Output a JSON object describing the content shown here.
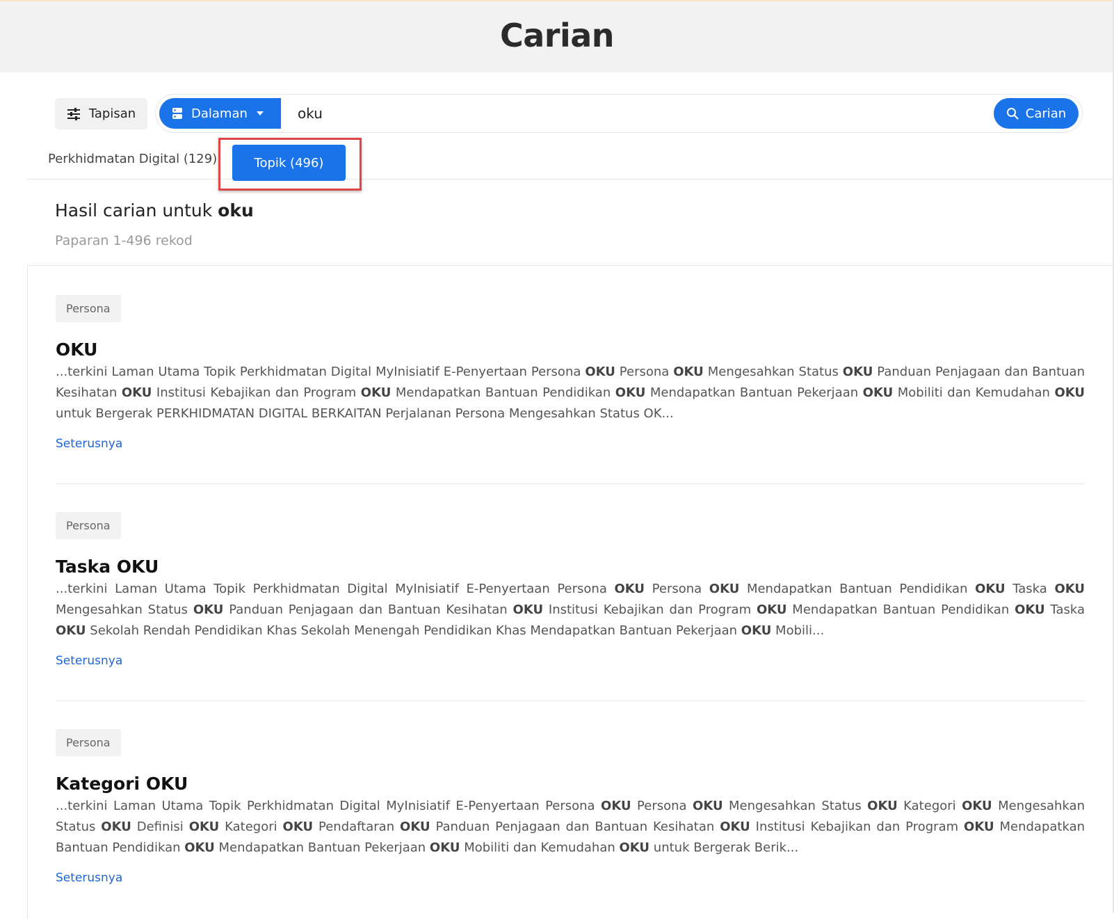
{
  "page": {
    "title": "Carian"
  },
  "toolbar": {
    "filter_label": "Tapisan",
    "scope_label": "Dalaman",
    "search_value": "oku",
    "search_button_label": "Carian"
  },
  "tabs": [
    {
      "label": "Perkhidmatan Digital (129)",
      "active": false
    },
    {
      "label": "Topik (496)",
      "active": true
    }
  ],
  "results_header": {
    "prefix": "Hasil carian untuk ",
    "query": "oku",
    "count_text": "Paparan 1-496 rekod"
  },
  "results": [
    {
      "badge": "Persona",
      "title": "OKU",
      "snippet": "...terkini Laman Utama Topik Perkhidmatan Digital MyInisiatif E-Penyertaan Persona OKU Persona OKU Mengesahkan Status OKU Panduan Penjagaan dan Bantuan Kesihatan OKU Institusi Kebajikan dan Program OKU Mendapatkan Bantuan Pendidikan OKU Mendapatkan Bantuan Pekerjaan OKU Mobiliti dan Kemudahan OKU untuk Bergerak PERKHIDMATAN DIGITAL BERKAITAN Perjalanan Persona Mengesahkan Status OK...",
      "more_label": "Seterusnya"
    },
    {
      "badge": "Persona",
      "title": "Taska OKU",
      "snippet": "...terkini Laman Utama Topik Perkhidmatan Digital MyInisiatif E-Penyertaan Persona OKU Persona OKU Mendapatkan Bantuan Pendidikan OKU Taska OKU Mengesahkan Status OKU Panduan Penjagaan dan Bantuan Kesihatan OKU Institusi Kebajikan dan Program OKU Mendapatkan Bantuan Pendidikan OKU Taska OKU Sekolah Rendah Pendidikan Khas Sekolah Menengah Pendidikan Khas Mendapatkan Bantuan Pekerjaan OKU Mobili...",
      "more_label": "Seterusnya"
    },
    {
      "badge": "Persona",
      "title": "Kategori OKU",
      "snippet": "...terkini Laman Utama Topik Perkhidmatan Digital MyInisiatif E-Penyertaan Persona OKU Persona OKU Mengesahkan Status OKU Kategori OKU Mengesahkan Status OKU Definisi OKU Kategori OKU Pendaftaran OKU Panduan Penjagaan dan Bantuan Kesihatan OKU Institusi Kebajikan dan Program OKU Mendapatkan Bantuan Pendidikan OKU Mendapatkan Bantuan Pekerjaan OKU Mobiliti dan Kemudahan OKU untuk Bergerak Berik...",
      "more_label": "Seterusnya"
    }
  ],
  "icons": {
    "filter": "sliders-icon",
    "scope": "server-icon",
    "dropdown": "caret-down-icon",
    "search": "magnifier-icon"
  },
  "colors": {
    "accent": "#1a73e8",
    "highlight": "#e04545",
    "header_bg": "#f2f2f2",
    "link": "#1a66d6"
  }
}
